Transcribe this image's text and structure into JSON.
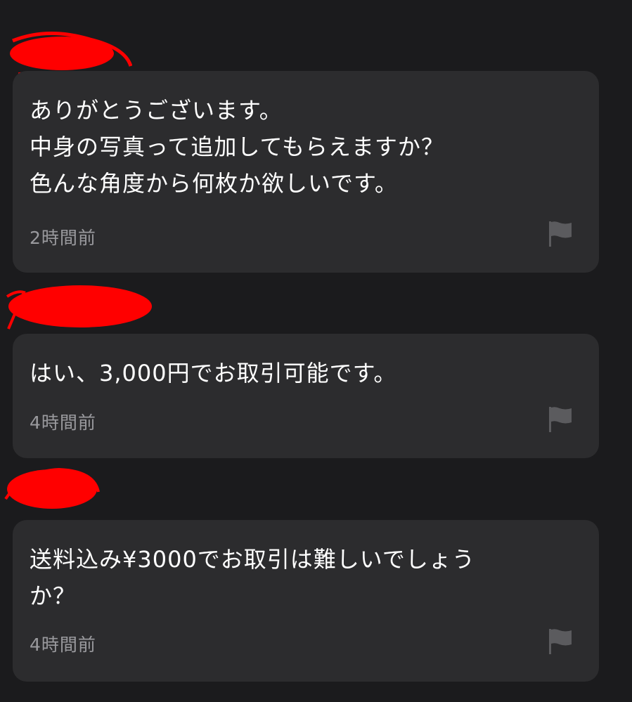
{
  "messages": [
    {
      "text": "ありがとうございます。\n中身の写真って追加してもらえますか？\n色んな角度から何枚か欲しいです。",
      "time": "2時間前",
      "flag_icon": "flag-icon"
    },
    {
      "text": "はい、3,000円でお取引可能です。",
      "time": "4時間前",
      "flag_icon": "flag-icon"
    },
    {
      "text": "送料込み¥3000でお取引は難しいでしょう\nか？",
      "time": "4時間前",
      "flag_icon": "flag-icon"
    }
  ],
  "colors": {
    "background": "#1b1b1d",
    "card": "#2c2c2e",
    "text": "#ffffff",
    "secondary_text": "#9a9a9e",
    "redaction": "#ff0000"
  }
}
